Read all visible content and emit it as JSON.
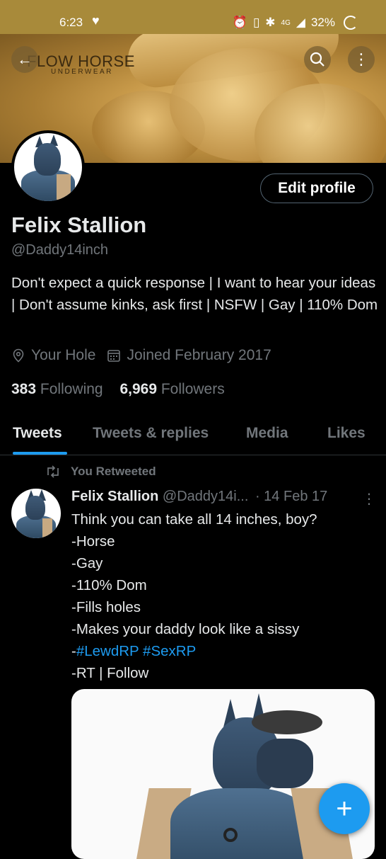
{
  "status_bar": {
    "time": "6:23",
    "network": "4G",
    "battery": "32%"
  },
  "banner": {
    "logo_main": "FLOW HORSE",
    "logo_sub": "UNDERWEAR"
  },
  "header": {
    "back_icon": "arrow-left-icon",
    "search_icon": "search-icon",
    "more_icon": "more-vertical-icon"
  },
  "profile": {
    "edit_label": "Edit profile",
    "name": "Felix Stallion",
    "handle": "@Daddy14inch",
    "bio": "Don't expect a quick response | I want to hear your ideas | Don't assume kinks, ask first | NSFW | Gay | 110% Dom",
    "location": "Your Hole",
    "joined": "Joined February 2017",
    "following_count": "383",
    "following_label": "Following",
    "followers_count": "6,969",
    "followers_label": "Followers"
  },
  "tabs": [
    "Tweets",
    "Tweets & replies",
    "Media",
    "Likes"
  ],
  "tweet": {
    "retweet_label": "You Retweeted",
    "name": "Felix Stallion",
    "handle": "@Daddy14i...",
    "date": "· 14 Feb 17",
    "lines": [
      "Think you can take all 14 inches, boy?",
      "-Horse",
      "-Gay",
      "-110% Dom",
      "-Fills holes",
      "-Makes your daddy look like a sissy"
    ],
    "hashtag_prefix": "-",
    "hashtags": "#LewdRP #SexRP",
    "last_line": "-RT | Follow"
  },
  "colors": {
    "accent": "#1d9bf0",
    "muted": "#71767b",
    "banner": "#c89a4a"
  }
}
